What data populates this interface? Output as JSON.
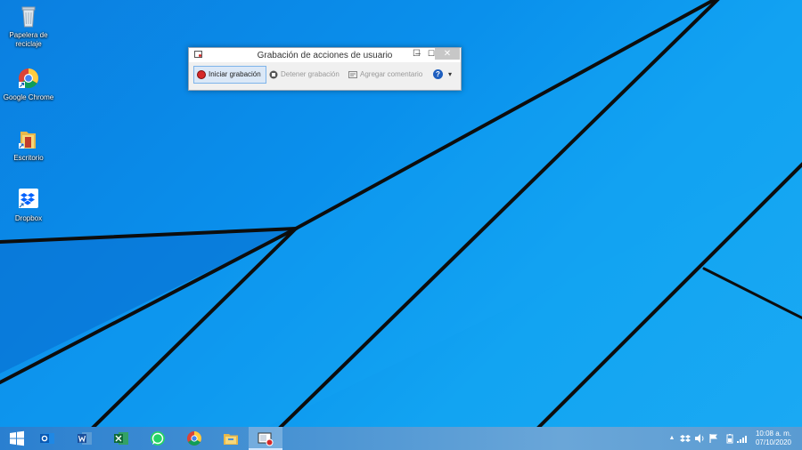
{
  "desktop": {
    "icons": [
      {
        "label": "Papelera de reciclaje",
        "icon": "recycle-bin-icon"
      },
      {
        "label": "Google Chrome",
        "icon": "chrome-icon"
      },
      {
        "label": "Escritorio",
        "icon": "folder-icon"
      },
      {
        "label": "Dropbox",
        "icon": "dropbox-icon"
      }
    ]
  },
  "psr_window": {
    "title": "Grabación de acciones de usuario",
    "controls": {
      "minimize": "–",
      "maximize": "☐",
      "close": "✕"
    },
    "toolbar": {
      "start_label": "Iniciar grabación",
      "stop_label": "Detener grabación",
      "comment_label": "Agregar comentario",
      "help_symbol": "?",
      "dropdown_symbol": "▾"
    }
  },
  "taskbar": {
    "apps": [
      "start-icon",
      "outlook-icon",
      "word-icon",
      "excel-icon",
      "whatsapp-icon",
      "chrome-icon",
      "file-explorer-icon",
      "steps-recorder-icon"
    ],
    "tray_icons": [
      "show-hidden-icons-icon",
      "dropbox-tray-icon",
      "volume-icon",
      "action-center-flag-icon",
      "battery-icon",
      "network-signal-icon"
    ],
    "tray_arrow": "▲",
    "time": "10:08 a. m.",
    "date": "07/10/2020"
  },
  "colors": {
    "accent": "#0a8ef0",
    "record_red": "#d62828",
    "help_blue": "#1f5fbf"
  }
}
